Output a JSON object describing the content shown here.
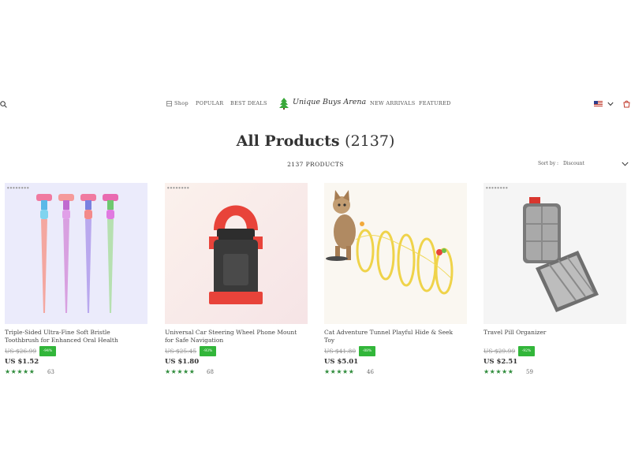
{
  "header": {
    "nav_left": [
      "Shop",
      "POPULAR",
      "BEST DEALS"
    ],
    "logo_text": "Unique Buys Arena",
    "nav_right": [
      "NEW ARRIVALS",
      "FEATURED"
    ]
  },
  "page": {
    "title": "All Products",
    "title_count": "(2137)",
    "product_count": "2137 PRODUCTS",
    "sort_label": "Sort by :",
    "sort_value": "Discount"
  },
  "colors": {
    "badge_green": "#32b63a",
    "star_green": "#2e8b3a"
  },
  "products": [
    {
      "name": "Triple-Sided Ultra-Fine Soft Bristle Toothbrush for Enhanced Oral Health",
      "old_price": "US $26.99",
      "price": "US $1.52",
      "stars": "★★★★★",
      "reviews": "63"
    },
    {
      "name": "Universal Car Steering Wheel Phone Mount for Safe Navigation",
      "old_price": "US $25.45",
      "price": "US $1.80",
      "stars": "★★★★★",
      "reviews": "68"
    },
    {
      "name": "Cat Adventure Tunnel Playful Hide & Seek Toy",
      "old_price": "US $41.80",
      "price": "US $5.01",
      "stars": "★★★★★",
      "reviews": "46"
    },
    {
      "name": "Travel Pill Organizer",
      "old_price": "US $29.99",
      "price": "US $2.51",
      "stars": "★★★★★",
      "reviews": "59"
    }
  ]
}
